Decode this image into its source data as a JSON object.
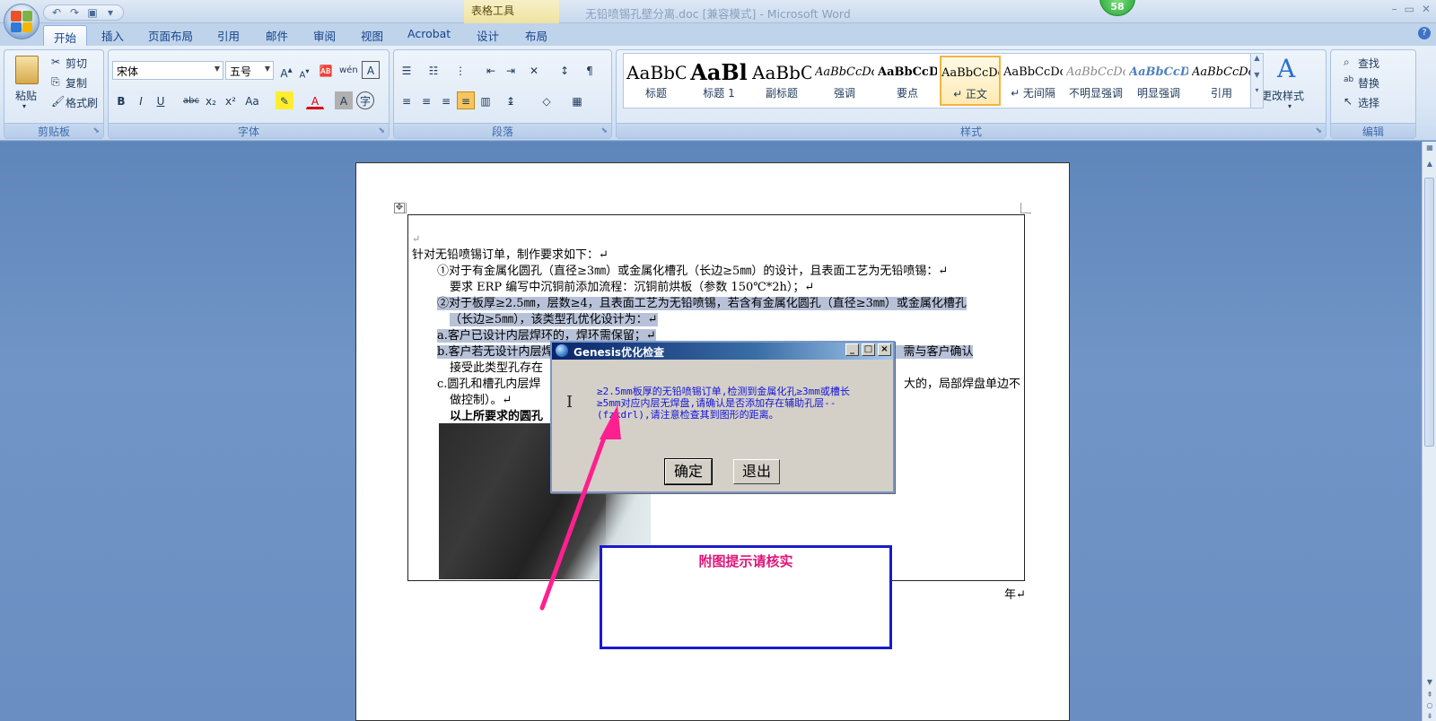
{
  "window": {
    "title": "无铅喷锡孔壁分离.doc [兼容模式] - Microsoft Word",
    "context_tab_group": "表格工具",
    "notification_badge": "58",
    "quick_access": [
      "undo-icon",
      "redo-icon",
      "save-icon",
      "customize-icon"
    ]
  },
  "ribbon_tabs": [
    {
      "label": "开始",
      "active": true
    },
    {
      "label": "插入"
    },
    {
      "label": "页面布局"
    },
    {
      "label": "引用"
    },
    {
      "label": "邮件"
    },
    {
      "label": "审阅"
    },
    {
      "label": "视图"
    },
    {
      "label": "Acrobat"
    },
    {
      "label": "设计"
    },
    {
      "label": "布局"
    }
  ],
  "clipboard": {
    "paste": "粘贴",
    "cut": "剪切",
    "copy": "复制",
    "format_painter": "格式刷",
    "label": "剪贴板"
  },
  "font": {
    "name": "宋体",
    "size": "五号",
    "label": "字体",
    "buttons": [
      "B",
      "I",
      "U",
      "abc",
      "x₂",
      "x²",
      "Aa",
      "A",
      "A"
    ]
  },
  "paragraph": {
    "label": "段落"
  },
  "styles": {
    "label": "样式",
    "change_styles": "更改样式",
    "items": [
      {
        "preview": "AaBbC",
        "name": "标题"
      },
      {
        "preview": "AaBl",
        "name": "标题 1"
      },
      {
        "preview": "AaBbC",
        "name": "副标题"
      },
      {
        "preview": "AaBbCcDc",
        "name": "强调"
      },
      {
        "preview": "AaBbCcD",
        "name": "要点"
      },
      {
        "preview": "AaBbCcDc",
        "name": "↵ 正文",
        "selected": true
      },
      {
        "preview": "AaBbCcDc",
        "name": "↵ 无间隔"
      },
      {
        "preview": "AaBbCcDc",
        "name": "不明显强调"
      },
      {
        "preview": "AaBbCcDc",
        "name": "明显强调"
      },
      {
        "preview": "AaBbCcDc",
        "name": "引用"
      }
    ]
  },
  "editing": {
    "label": "编辑",
    "find": "查找",
    "replace": "替换",
    "select": "选择"
  },
  "document": {
    "lines": [
      "↵",
      "针对无铅喷锡订单，制作要求如下：↵",
      "①对于有金属化圆孔（直径≥3㎜）或金属化槽孔（长边≥5㎜）的设计，且表面工艺为无铅喷锡：↵",
      "要求 ERP 编写中沉铜前添加流程：沉铜前烘板（参数 150℃*2h）；↵",
      "②对于板厚≥2.5㎜，层数≥4，且表面工艺为无铅喷锡，若含有金属化圆孔（直径≥3㎜）或金属化槽孔",
      "（长边≥5㎜），该类型孔优化设计为：↵",
      "a.客户已设计内层焊环的，焊环需保留；↵",
      "b.客户若无设计内层焊环，工程预审需建议此类圆孔或槽孔增加内层焊环，若客户不同意，需与客户确认",
      "接受此类型孔存在",
      "c.圆孔和槽孔内层焊",
      "做控制）。↵",
      "以上所要求的圆孔"
    ],
    "line_right_fragments": {
      "c_line": "大的，局部焊盘单边不"
    },
    "trailing_char": "年↵"
  },
  "dialog": {
    "title": "Genesis优化检查",
    "message": "≥2.5mm板厚的无铅喷锡订单,检测到金属化孔≥3mm或槽长≥5mm对应内层无焊盘,请确认是否添加存在辅助孔层--(fzkdrl),请注意检查其到图形的距离。",
    "ok": "确定",
    "exit": "退出",
    "controls": [
      "_",
      "□",
      "×"
    ]
  },
  "callout": {
    "text": "附图提示请核实"
  },
  "colors": {
    "arrow": "#ff1f8e",
    "callout_border": "#1a1acc",
    "callout_text": "#e0157a",
    "dialog_text": "#1515d8",
    "highlight": "#b7c2d9"
  }
}
